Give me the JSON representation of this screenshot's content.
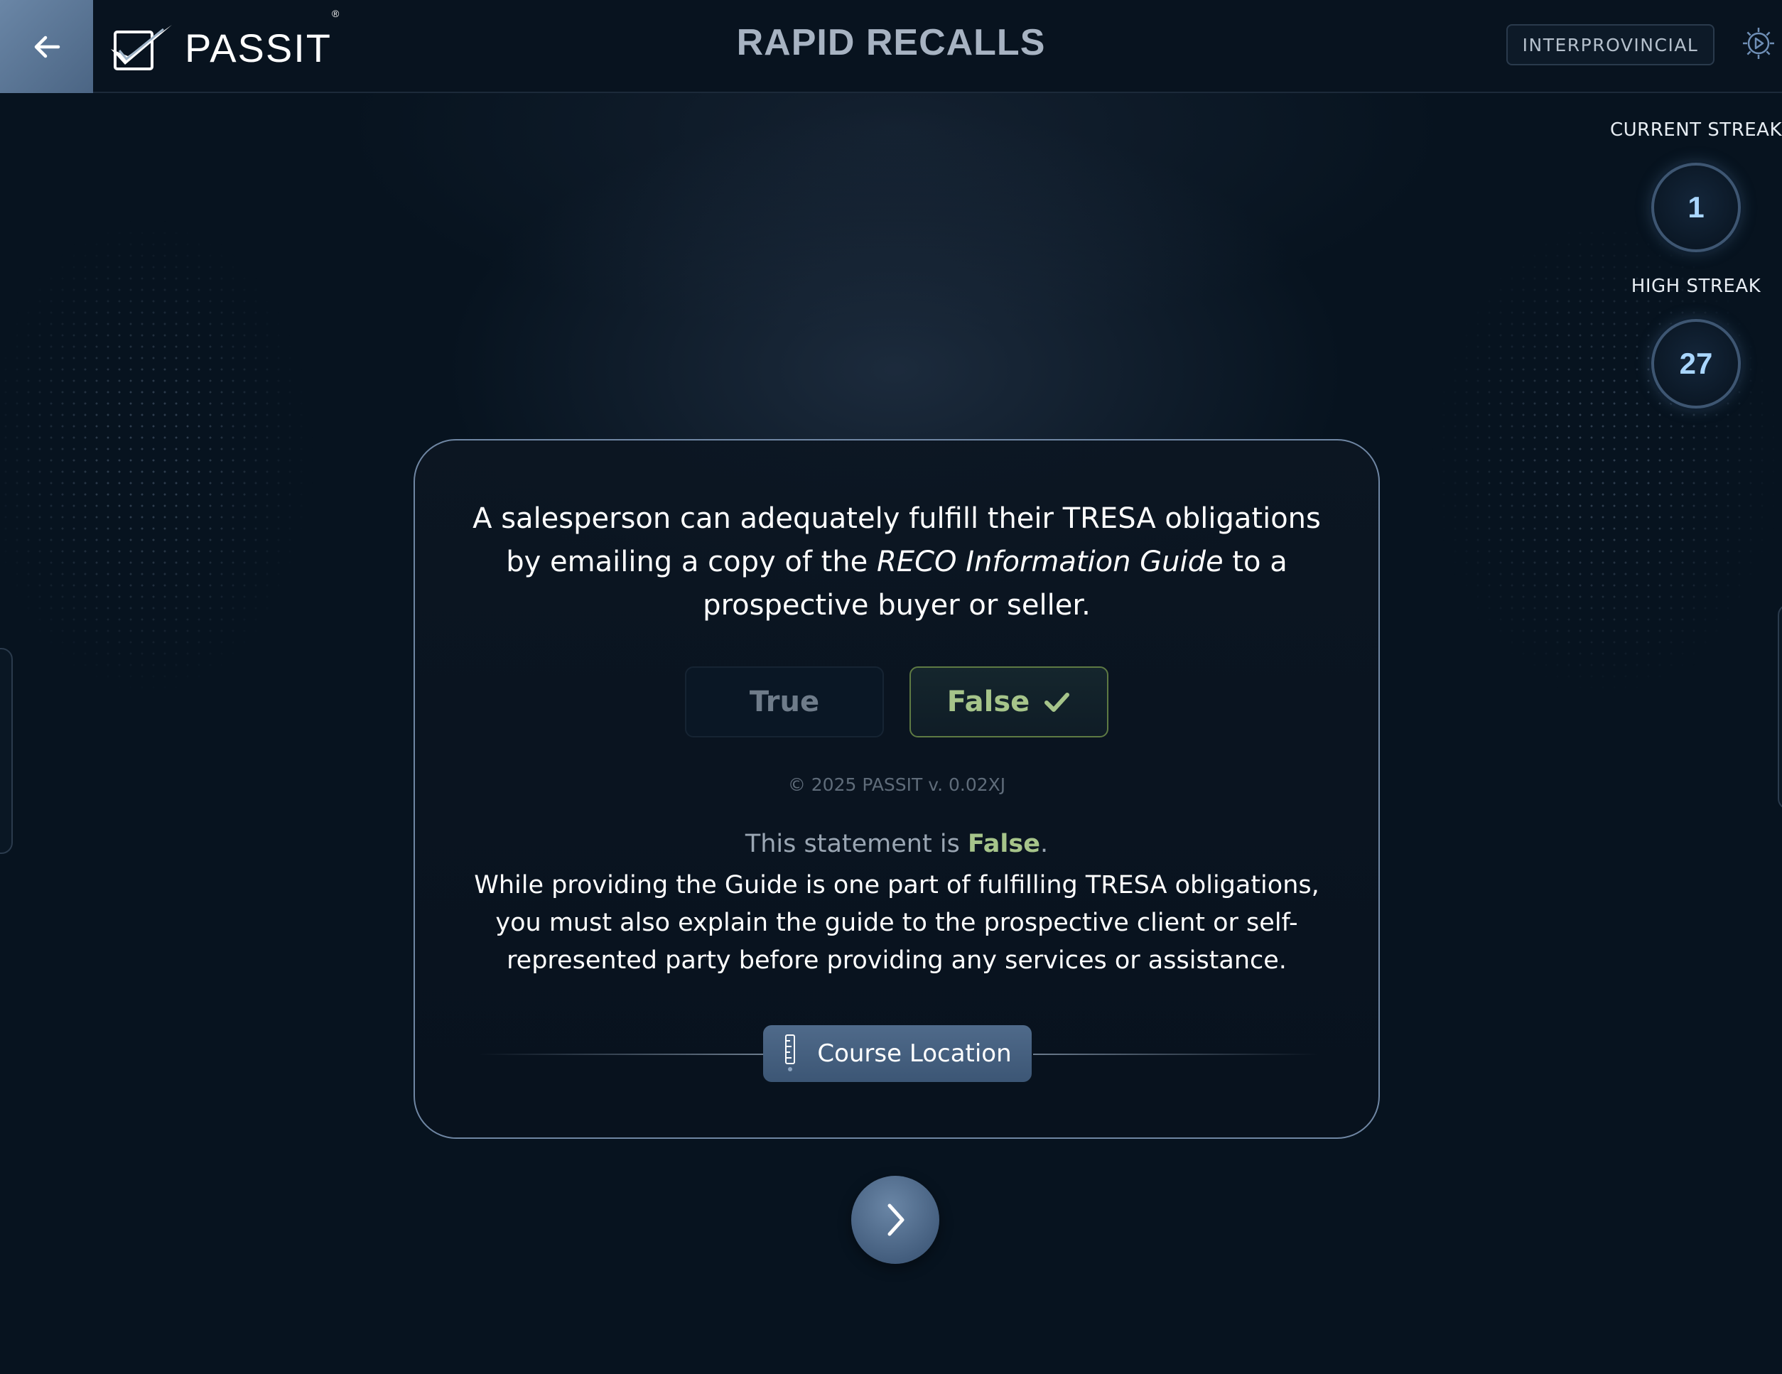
{
  "header": {
    "logo_text": "PASSIT",
    "logo_mark": "®",
    "title": "RAPID RECALLS",
    "region": "INTERPROVINCIAL",
    "icons": {
      "back": "arrow-left-icon",
      "settings": "gear-icon",
      "logo": "checkmark-logo-icon"
    }
  },
  "streaks": {
    "current_label": "CURRENT STREAK",
    "current_value": "1",
    "high_label": "HIGH STREAK",
    "high_value": "27"
  },
  "question": {
    "text_before": "A salesperson can adequately fulfill their TRESA obligations by emailing a copy of the ",
    "text_italic": "RECO Information Guide",
    "text_after": " to a prospective buyer or seller."
  },
  "answers": {
    "true_label": "True",
    "false_label": "False",
    "selected": "False",
    "icons": {
      "correct": "checkmark-icon"
    }
  },
  "footer": {
    "copyright": "© 2025 PASSIT v. 0.02XJ"
  },
  "result": {
    "prefix": "This statement is ",
    "verdict": "False",
    "suffix": ".",
    "explanation": "While providing the Guide is one part of fulfilling TRESA obligations, you must also explain the guide to the prospective client or self-represented party before providing any services or assistance."
  },
  "course_location": {
    "label": "Course Location",
    "icon": "ruler-icon"
  },
  "navigation": {
    "next_icon": "chevron-right-icon"
  },
  "colors": {
    "background": "#07131f",
    "card_border": "#6f86a3",
    "correct_green": "#a6c48a",
    "accent_blue": "#4f6a8a",
    "streak_number": "#a9d6ff"
  }
}
